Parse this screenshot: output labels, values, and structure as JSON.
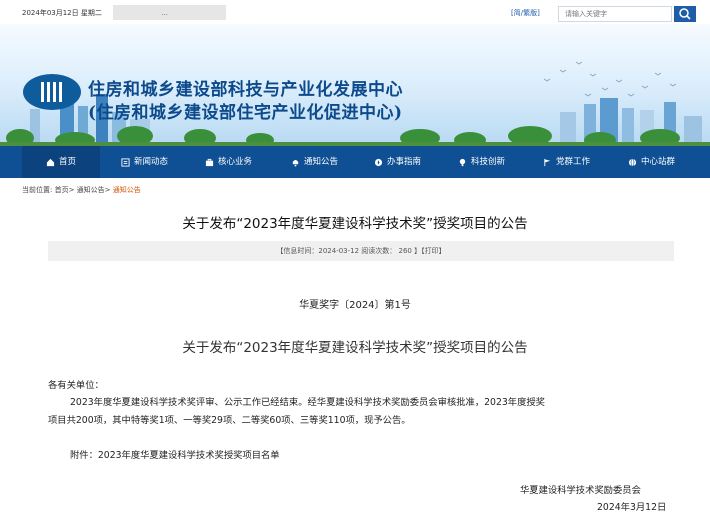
{
  "topbar": {
    "date": "2024年03月12日 星期二",
    "blurred_text": "…",
    "simplified": "[简/繁版]",
    "search_placeholder": "请输入关键字",
    "search_icon": "search-icon"
  },
  "banner": {
    "title_line1": "住房和城乡建设部科技与产业化发展中心",
    "title_line2": "(住房和城乡建设部住宅产业化促进中心)"
  },
  "nav": {
    "items": [
      {
        "label": "首页",
        "icon": "home-icon"
      },
      {
        "label": "新闻动态",
        "icon": "news-icon"
      },
      {
        "label": "核心业务",
        "icon": "briefcase-icon"
      },
      {
        "label": "通知公告",
        "icon": "bell-icon"
      },
      {
        "label": "办事指南",
        "icon": "compass-icon"
      },
      {
        "label": "科技创新",
        "icon": "bulb-icon"
      },
      {
        "label": "党群工作",
        "icon": "flag-icon"
      },
      {
        "label": "中心站群",
        "icon": "globe-icon"
      }
    ]
  },
  "breadcrumb": {
    "prefix": "当前位置: 首页> 通知公告> ",
    "current": "通知公告"
  },
  "article": {
    "title": "关于发布“2023年度华夏建设科学技术奖”授奖项目的公告",
    "meta": "【信息时间：2024-03-12  阅读次数：  260 】【打印】",
    "doc_number": "华夏奖字〔2024〕第1号",
    "subtitle": "关于发布“2023年度华夏建设科学技术奖”授奖项目的公告",
    "salutation": "各有关单位：",
    "para1_line1": "2023年度华夏建设科学技术奖评审、公示工作已经结束。经华夏建设科学技术奖励委员会审核批准，2023年度授奖",
    "para1_line2": "项目共200项，其中特等奖1项、一等奖29项、二等奖60项、三等奖110项，现予公告。",
    "attachment": "附件：2023年度华夏建设科学技术奖授奖项目名单",
    "signature": "华夏建设科学技术奖励委员会",
    "sign_date": "2024年3月12日"
  }
}
